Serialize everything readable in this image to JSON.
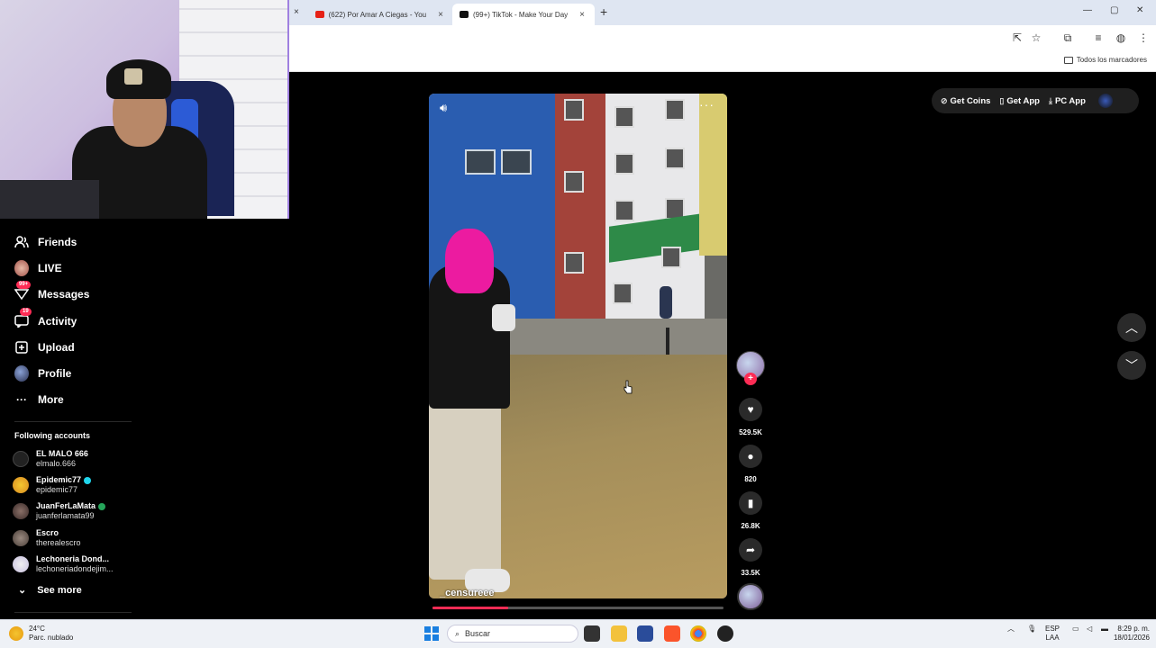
{
  "browser": {
    "tabs": [
      {
        "title": "(622) Por Amar A Ciegas - YouT",
        "close": "×"
      },
      {
        "title": "(99+) TikTok - Make Your Day",
        "close": "×"
      }
    ],
    "close_left": "×",
    "new_tab": "+",
    "window_controls": [
      "—",
      "▢",
      "✕"
    ],
    "bookmarks_label": "Todos los marcadores"
  },
  "sidebar": {
    "items": [
      {
        "label": "Friends",
        "icon": "friends-icon"
      },
      {
        "label": "LIVE",
        "icon": "live-icon"
      },
      {
        "label": "Messages",
        "icon": "messages-icon",
        "badge": "99+"
      },
      {
        "label": "Activity",
        "icon": "activity-icon",
        "badge": "19"
      },
      {
        "label": "Upload",
        "icon": "upload-icon"
      },
      {
        "label": "Profile",
        "icon": "profile-icon"
      },
      {
        "label": "More",
        "icon": "more-icon"
      }
    ],
    "following_title": "Following accounts",
    "accounts": [
      {
        "name": "EL MALO 666",
        "username": "elmalo.666",
        "verified": ""
      },
      {
        "name": "Epidemic77",
        "username": "epidemic77",
        "verified": "blue"
      },
      {
        "name": "JuanFerLaMata",
        "username": "juanferlamata99",
        "verified": "green"
      },
      {
        "name": "Escro",
        "username": "therealescro",
        "verified": ""
      },
      {
        "name": "Lechoneria Dond...",
        "username": "lechoneriadondejim...",
        "verified": ""
      }
    ],
    "see_more": "See more"
  },
  "topbar": {
    "get_coins": "Get Coins",
    "get_app": "Get App",
    "pc_app": "PC App"
  },
  "video": {
    "author": "_censureee",
    "progress": 0.26
  },
  "actions": {
    "likes": "529.5K",
    "comments": "820",
    "saves": "26.8K",
    "shares": "33.5K"
  },
  "taskbar": {
    "temperature": "24°C",
    "weather": "Parc. nublado",
    "search_placeholder": "Buscar",
    "lang_top": "ESP",
    "lang_bottom": "LAA",
    "time": "8:29 p. m.",
    "date": "18/01/2026"
  }
}
